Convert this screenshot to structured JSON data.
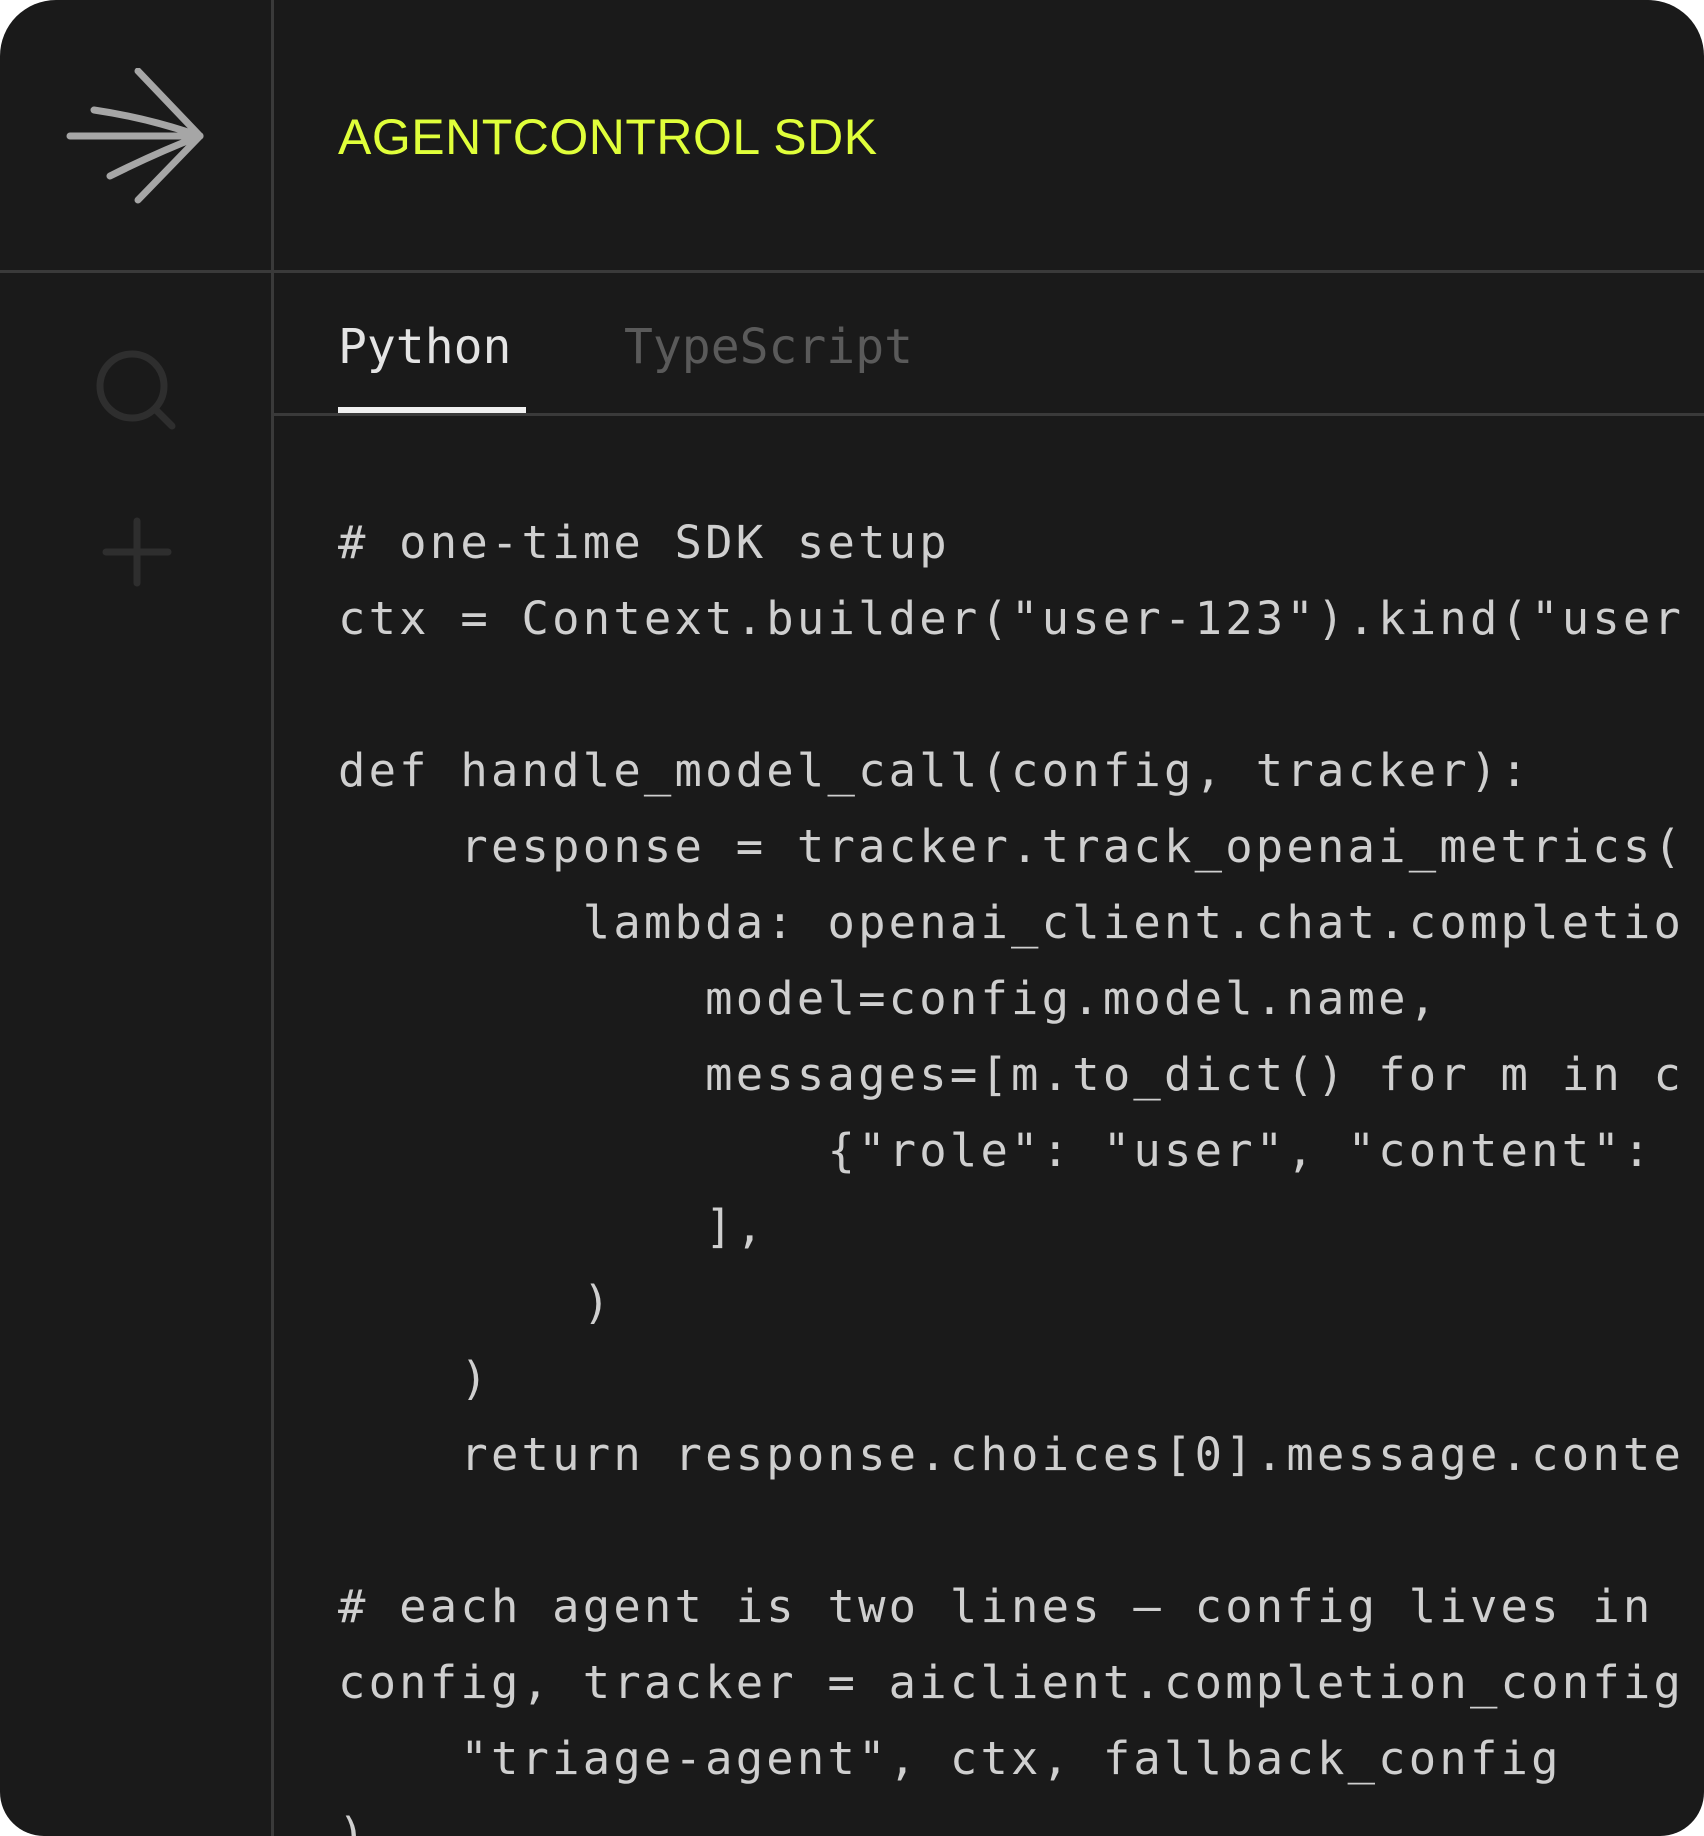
{
  "header": {
    "title": "AGENTCONTROL SDK"
  },
  "sidebar": {
    "logo_icon": "arrow-burst-icon",
    "items": [
      {
        "icon": "search-icon"
      },
      {
        "icon": "plus-icon"
      }
    ]
  },
  "tabs": [
    {
      "label": "Python",
      "active": true
    },
    {
      "label": "TypeScript",
      "active": false
    }
  ],
  "code": {
    "language": "Python",
    "lines": [
      "# one-time SDK setup",
      "ctx = Context.builder(\"user-123\").kind(\"user",
      "",
      "def handle_model_call(config, tracker):",
      "    response = tracker.track_openai_metrics(",
      "        lambda: openai_client.chat.completio",
      "            model=config.model.name,",
      "            messages=[m.to_dict() for m in c",
      "                {\"role\": \"user\", \"content\":",
      "            ],",
      "        )",
      "    )",
      "    return response.choices[0].message.conte",
      "",
      "# each agent is two lines — config lives in",
      "config, tracker = aiclient.completion_config",
      "    \"triage-agent\", ctx, fallback_config",
      ")"
    ]
  },
  "colors": {
    "background": "#1a1a1a",
    "accent": "#e0ff3a",
    "divider": "#3a3a3a",
    "code_text": "#cfcfcf",
    "tab_active": "#e4e4e4",
    "tab_inactive": "#5a5a5a"
  }
}
